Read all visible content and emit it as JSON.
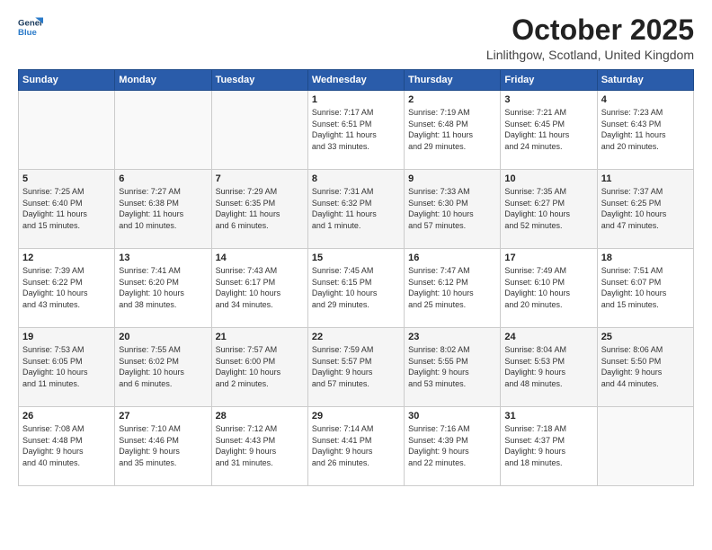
{
  "logo": {
    "line1": "General",
    "line2": "Blue"
  },
  "title": "October 2025",
  "location": "Linlithgow, Scotland, United Kingdom",
  "days_header": [
    "Sunday",
    "Monday",
    "Tuesday",
    "Wednesday",
    "Thursday",
    "Friday",
    "Saturday"
  ],
  "weeks": [
    [
      {
        "num": "",
        "detail": ""
      },
      {
        "num": "",
        "detail": ""
      },
      {
        "num": "",
        "detail": ""
      },
      {
        "num": "1",
        "detail": "Sunrise: 7:17 AM\nSunset: 6:51 PM\nDaylight: 11 hours\nand 33 minutes."
      },
      {
        "num": "2",
        "detail": "Sunrise: 7:19 AM\nSunset: 6:48 PM\nDaylight: 11 hours\nand 29 minutes."
      },
      {
        "num": "3",
        "detail": "Sunrise: 7:21 AM\nSunset: 6:45 PM\nDaylight: 11 hours\nand 24 minutes."
      },
      {
        "num": "4",
        "detail": "Sunrise: 7:23 AM\nSunset: 6:43 PM\nDaylight: 11 hours\nand 20 minutes."
      }
    ],
    [
      {
        "num": "5",
        "detail": "Sunrise: 7:25 AM\nSunset: 6:40 PM\nDaylight: 11 hours\nand 15 minutes."
      },
      {
        "num": "6",
        "detail": "Sunrise: 7:27 AM\nSunset: 6:38 PM\nDaylight: 11 hours\nand 10 minutes."
      },
      {
        "num": "7",
        "detail": "Sunrise: 7:29 AM\nSunset: 6:35 PM\nDaylight: 11 hours\nand 6 minutes."
      },
      {
        "num": "8",
        "detail": "Sunrise: 7:31 AM\nSunset: 6:32 PM\nDaylight: 11 hours\nand 1 minute."
      },
      {
        "num": "9",
        "detail": "Sunrise: 7:33 AM\nSunset: 6:30 PM\nDaylight: 10 hours\nand 57 minutes."
      },
      {
        "num": "10",
        "detail": "Sunrise: 7:35 AM\nSunset: 6:27 PM\nDaylight: 10 hours\nand 52 minutes."
      },
      {
        "num": "11",
        "detail": "Sunrise: 7:37 AM\nSunset: 6:25 PM\nDaylight: 10 hours\nand 47 minutes."
      }
    ],
    [
      {
        "num": "12",
        "detail": "Sunrise: 7:39 AM\nSunset: 6:22 PM\nDaylight: 10 hours\nand 43 minutes."
      },
      {
        "num": "13",
        "detail": "Sunrise: 7:41 AM\nSunset: 6:20 PM\nDaylight: 10 hours\nand 38 minutes."
      },
      {
        "num": "14",
        "detail": "Sunrise: 7:43 AM\nSunset: 6:17 PM\nDaylight: 10 hours\nand 34 minutes."
      },
      {
        "num": "15",
        "detail": "Sunrise: 7:45 AM\nSunset: 6:15 PM\nDaylight: 10 hours\nand 29 minutes."
      },
      {
        "num": "16",
        "detail": "Sunrise: 7:47 AM\nSunset: 6:12 PM\nDaylight: 10 hours\nand 25 minutes."
      },
      {
        "num": "17",
        "detail": "Sunrise: 7:49 AM\nSunset: 6:10 PM\nDaylight: 10 hours\nand 20 minutes."
      },
      {
        "num": "18",
        "detail": "Sunrise: 7:51 AM\nSunset: 6:07 PM\nDaylight: 10 hours\nand 15 minutes."
      }
    ],
    [
      {
        "num": "19",
        "detail": "Sunrise: 7:53 AM\nSunset: 6:05 PM\nDaylight: 10 hours\nand 11 minutes."
      },
      {
        "num": "20",
        "detail": "Sunrise: 7:55 AM\nSunset: 6:02 PM\nDaylight: 10 hours\nand 6 minutes."
      },
      {
        "num": "21",
        "detail": "Sunrise: 7:57 AM\nSunset: 6:00 PM\nDaylight: 10 hours\nand 2 minutes."
      },
      {
        "num": "22",
        "detail": "Sunrise: 7:59 AM\nSunset: 5:57 PM\nDaylight: 9 hours\nand 57 minutes."
      },
      {
        "num": "23",
        "detail": "Sunrise: 8:02 AM\nSunset: 5:55 PM\nDaylight: 9 hours\nand 53 minutes."
      },
      {
        "num": "24",
        "detail": "Sunrise: 8:04 AM\nSunset: 5:53 PM\nDaylight: 9 hours\nand 48 minutes."
      },
      {
        "num": "25",
        "detail": "Sunrise: 8:06 AM\nSunset: 5:50 PM\nDaylight: 9 hours\nand 44 minutes."
      }
    ],
    [
      {
        "num": "26",
        "detail": "Sunrise: 7:08 AM\nSunset: 4:48 PM\nDaylight: 9 hours\nand 40 minutes."
      },
      {
        "num": "27",
        "detail": "Sunrise: 7:10 AM\nSunset: 4:46 PM\nDaylight: 9 hours\nand 35 minutes."
      },
      {
        "num": "28",
        "detail": "Sunrise: 7:12 AM\nSunset: 4:43 PM\nDaylight: 9 hours\nand 31 minutes."
      },
      {
        "num": "29",
        "detail": "Sunrise: 7:14 AM\nSunset: 4:41 PM\nDaylight: 9 hours\nand 26 minutes."
      },
      {
        "num": "30",
        "detail": "Sunrise: 7:16 AM\nSunset: 4:39 PM\nDaylight: 9 hours\nand 22 minutes."
      },
      {
        "num": "31",
        "detail": "Sunrise: 7:18 AM\nSunset: 4:37 PM\nDaylight: 9 hours\nand 18 minutes."
      },
      {
        "num": "",
        "detail": ""
      }
    ]
  ]
}
